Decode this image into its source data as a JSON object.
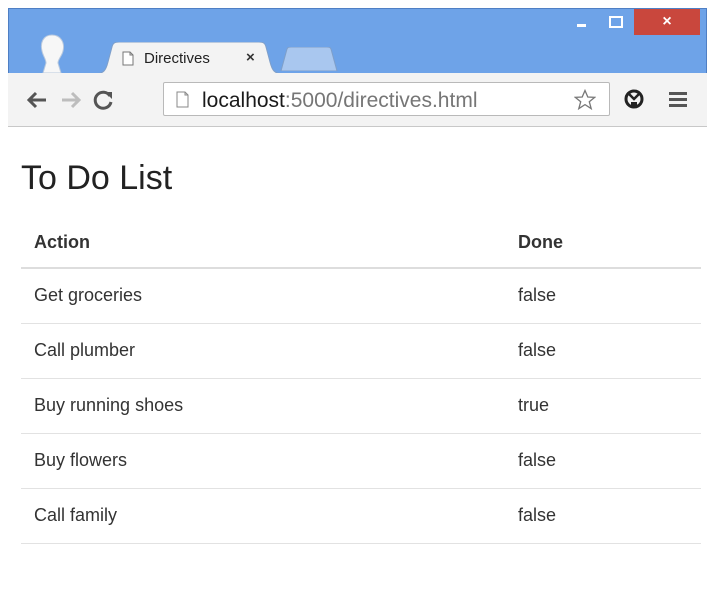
{
  "browser": {
    "tab": {
      "title": "Directives",
      "close_glyph": "×"
    },
    "window_controls": {
      "minimize": "–",
      "close": "×"
    },
    "address_bar": {
      "host": "localhost",
      "rest": ":5000/directives.html"
    }
  },
  "page": {
    "title": "To Do List",
    "table": {
      "headers": {
        "action": "Action",
        "done": "Done"
      },
      "rows": [
        {
          "action": "Get groceries",
          "done": "false"
        },
        {
          "action": "Call plumber",
          "done": "false"
        },
        {
          "action": "Buy running shoes",
          "done": "true"
        },
        {
          "action": "Buy flowers",
          "done": "false"
        },
        {
          "action": "Call family",
          "done": "false"
        }
      ]
    }
  },
  "colors": {
    "frame": "#6ea3e8",
    "close_button": "#c9473d",
    "toolbar": "#f3f3f3"
  }
}
